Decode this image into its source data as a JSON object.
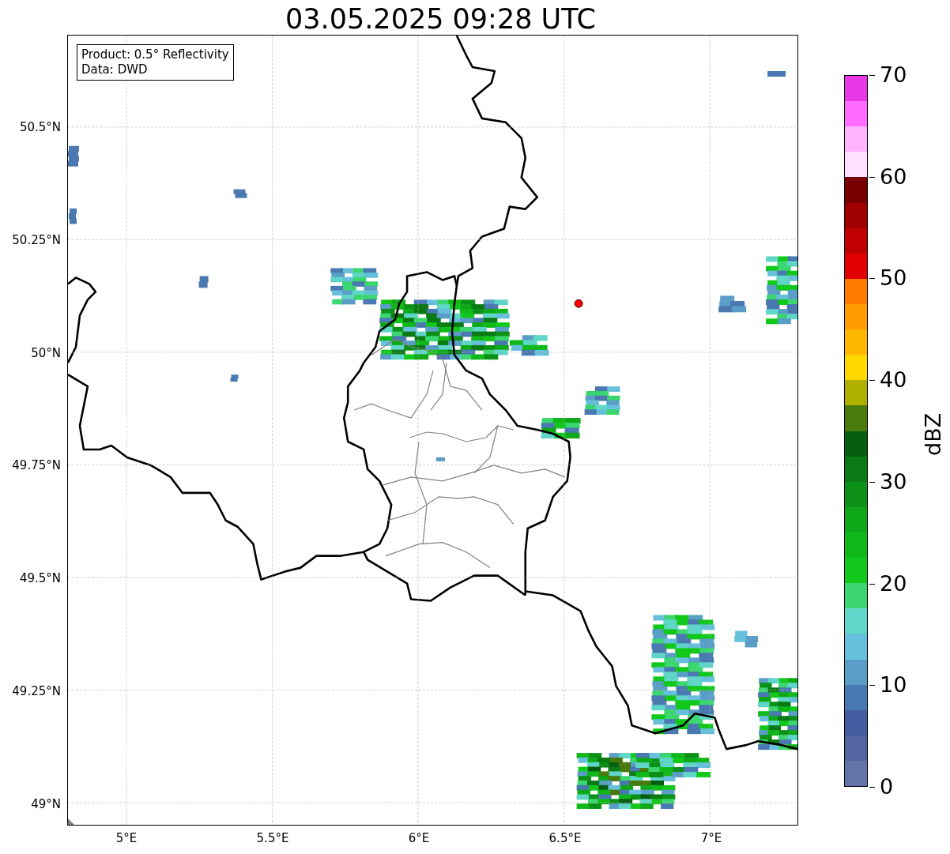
{
  "figure": {
    "title": "03.05.2025 09:28 UTC"
  },
  "map": {
    "info_box": [
      "Product: 0.5° Reflectivity",
      "Data: DWD"
    ],
    "chart_data": {
      "type": "scatter",
      "xlim": [
        4.8,
        7.3
      ],
      "ylim": [
        48.951,
        50.703
      ],
      "grid": true,
      "xticks": [
        {
          "value": 5,
          "label": "5°E"
        },
        {
          "value": 5.5,
          "label": "5.5°E"
        },
        {
          "value": 6,
          "label": "6°E"
        },
        {
          "value": 6.5,
          "label": "6.5°E"
        },
        {
          "value": 7,
          "label": "7°E"
        }
      ],
      "yticks": [
        {
          "value": 50.5,
          "label": "50.5°N"
        },
        {
          "value": 50.25,
          "label": "50.25°N"
        },
        {
          "value": 50,
          "label": "50°N"
        },
        {
          "value": 49.75,
          "label": "49.75°N"
        },
        {
          "value": 49.5,
          "label": "49.5°N"
        },
        {
          "value": 49.25,
          "label": "49.25°N"
        },
        {
          "value": 49,
          "label": "49°N"
        }
      ],
      "x": [
        6.55
      ],
      "series": [
        {
          "color": "#ff0000",
          "values": [
            50.108
          ]
        }
      ]
    }
  },
  "colorbar": {
    "label": "dBZ",
    "ticks": [
      "70",
      "60",
      "50",
      "40",
      "30",
      "20",
      "10",
      "0"
    ],
    "bins": [
      {
        "color": "#e838e8"
      },
      {
        "color": "#ff6cff"
      },
      {
        "color": "#ffb4ff"
      },
      {
        "color": "#ffe0ff"
      },
      {
        "color": "#780000"
      },
      {
        "color": "#a00000"
      },
      {
        "color": "#c00000"
      },
      {
        "color": "#e00000"
      },
      {
        "color": "#ff7c00"
      },
      {
        "color": "#ff9c00"
      },
      {
        "color": "#ffb800"
      },
      {
        "color": "#ffd800"
      },
      {
        "color": "#b0b000"
      },
      {
        "color": "#4a7a0e"
      },
      {
        "color": "#075e10"
      },
      {
        "color": "#0a7a14"
      },
      {
        "color": "#0c9018"
      },
      {
        "color": "#0ea818"
      },
      {
        "color": "#10b81a"
      },
      {
        "color": "#12c81a"
      },
      {
        "color": "#3cd670"
      },
      {
        "color": "#5fd6c8"
      },
      {
        "color": "#66c0dc"
      },
      {
        "color": "#5a9ec8"
      },
      {
        "color": "#4a78b0"
      },
      {
        "color": "#435ea0"
      },
      {
        "color": "#5464a0"
      },
      {
        "color": "#6574a8"
      }
    ]
  }
}
